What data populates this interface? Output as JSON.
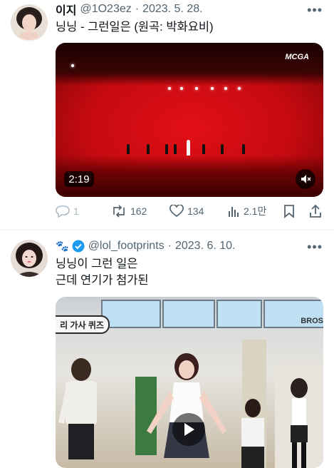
{
  "tweets": [
    {
      "display_name": "이지",
      "handle": "@1O23ez",
      "separator": "·",
      "date": "2023. 5. 28.",
      "text": "닝닝 - 그런일은 (원곡: 박화요비)",
      "video": {
        "duration": "2:19",
        "logo": "MCGA"
      },
      "actions": {
        "replies": "1",
        "retweets": "162",
        "likes": "134",
        "views": "2.1만"
      }
    },
    {
      "emoji": "🐾",
      "verified_color": "#1d9bf0",
      "handle": "@lol_footprints",
      "separator": "·",
      "date": "2023. 6. 10.",
      "text_line1": "닝닝이 그런 일은",
      "text_line2": "근데 연기가 첨가된",
      "video": {
        "caption": "리 가사 퀴즈",
        "brand": "BROS"
      }
    }
  ],
  "colors": {
    "secondary_text": "#536471",
    "accent": "#1d9bf0",
    "divider": "#eff3f4"
  },
  "icons": [
    "more-icon",
    "reply-icon",
    "retweet-icon",
    "like-icon",
    "views-icon",
    "bookmark-icon",
    "share-icon",
    "mute-icon",
    "play-icon",
    "verified-badge-icon",
    "paw-emoji-icon"
  ]
}
